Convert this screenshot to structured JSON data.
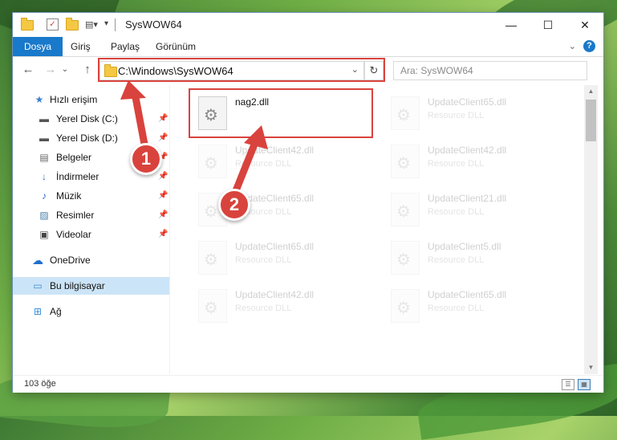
{
  "window": {
    "title": "SysWOW64",
    "controls": {
      "minimize": "—",
      "maximize": "☐",
      "close": "✕"
    }
  },
  "ribbon": {
    "tabs": [
      "Dosya",
      "Giriş",
      "Paylaş",
      "Görünüm"
    ],
    "help": "?",
    "collapse": "⌄"
  },
  "nav": {
    "back": "←",
    "forward": "→",
    "recent": "⌄",
    "up": "↑",
    "address": "C:\\Windows\\SysWOW64",
    "address_dropdown": "⌄",
    "refresh": "↻",
    "search_placeholder": "Ara: SysWOW64"
  },
  "sidebar": {
    "items": [
      {
        "label": "Hızlı erişim",
        "icon": "star-icon",
        "pinned": false
      },
      {
        "label": "Yerel Disk (C:)",
        "icon": "drive-icon",
        "pinned": true
      },
      {
        "label": "Yerel Disk (D:)",
        "icon": "drive-icon",
        "pinned": true
      },
      {
        "label": "Belgeler",
        "icon": "documents-icon",
        "pinned": true
      },
      {
        "label": "İndirmeler",
        "icon": "download-icon",
        "pinned": true
      },
      {
        "label": "Müzik",
        "icon": "music-icon",
        "pinned": true
      },
      {
        "label": "Resimler",
        "icon": "pictures-icon",
        "pinned": true
      },
      {
        "label": "Videolar",
        "icon": "video-icon",
        "pinned": true
      },
      {
        "label": "OneDrive",
        "icon": "cloud-icon",
        "pinned": false
      },
      {
        "label": "Bu bilgisayar",
        "icon": "computer-icon",
        "pinned": false,
        "selected": true
      },
      {
        "label": "Ağ",
        "icon": "network-icon",
        "pinned": false
      }
    ]
  },
  "files": [
    {
      "name": "nag2.dll",
      "type": "",
      "highlighted": true
    },
    {
      "name": "UpdateClient65.dll",
      "type": "Resource DLL"
    },
    {
      "name": "UpdateClient42.dll",
      "type": "Resource DLL"
    },
    {
      "name": "UpdateClient42.dll",
      "type": "Resource DLL"
    },
    {
      "name": "UpdateClient65.dll",
      "type": "Resource DLL"
    },
    {
      "name": "UpdateClient21.dll",
      "type": "Resource DLL"
    },
    {
      "name": "UpdateClient65.dll",
      "type": "Resource DLL"
    },
    {
      "name": "UpdateClient5.dll",
      "type": "Resource DLL"
    },
    {
      "name": "UpdateClient42.dll",
      "type": "Resource DLL"
    },
    {
      "name": "UpdateClient65.dll",
      "type": "Resource DLL"
    }
  ],
  "status": {
    "item_count": "103 öğe"
  },
  "annotations": {
    "step1": "1",
    "step2": "2",
    "highlight_color": "#d9433d"
  },
  "colors": {
    "accent": "#1979ca",
    "selection": "#cce4f7"
  }
}
